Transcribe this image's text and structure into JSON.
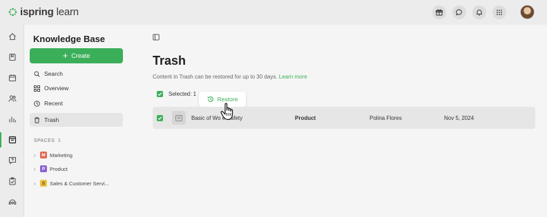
{
  "app": {
    "logo_text_prefix": "ispring",
    "logo_text_suffix": " learn",
    "brand_color": "#3bae5a"
  },
  "topbar": {
    "icons": [
      "gift-icon",
      "chat-icon",
      "bell-icon",
      "apps-grid-icon"
    ],
    "avatar": "user-avatar"
  },
  "rail": {
    "items": [
      "home-icon",
      "book-icon",
      "calendar-icon",
      "users-icon",
      "reports-icon",
      "knowledge-base-icon",
      "question-icon",
      "assignments-icon",
      "support-icon"
    ],
    "active_index": 5
  },
  "sidebar": {
    "title": "Knowledge Base",
    "create_label": "Create",
    "nav": [
      {
        "label": "Search",
        "icon": "search-icon"
      },
      {
        "label": "Overview",
        "icon": "grid-icon"
      },
      {
        "label": "Recent",
        "icon": "clock-icon"
      },
      {
        "label": "Trash",
        "icon": "trash-icon",
        "selected": true
      }
    ],
    "spaces_label": "SPACES",
    "spaces_count": "3",
    "spaces": [
      {
        "letter": "M",
        "label": "Marketing",
        "color": "#e0664f"
      },
      {
        "letter": "P",
        "label": "Product",
        "color": "#8a63d2"
      },
      {
        "letter": "S",
        "label": "Sales & Customer Servi...",
        "color": "#e8c23d"
      }
    ]
  },
  "main": {
    "title": "Trash",
    "info_text": "Content in Trash can be restored for up to 30 days.",
    "info_link": "Learn more",
    "selected_text": "Selected: 1",
    "restore_label": "Restore",
    "rows": [
      {
        "name": "Basic of Wo     e Safety",
        "space": "Product",
        "author": "Polina Flores",
        "date": "Nov 5, 2024",
        "checked": true
      }
    ]
  }
}
